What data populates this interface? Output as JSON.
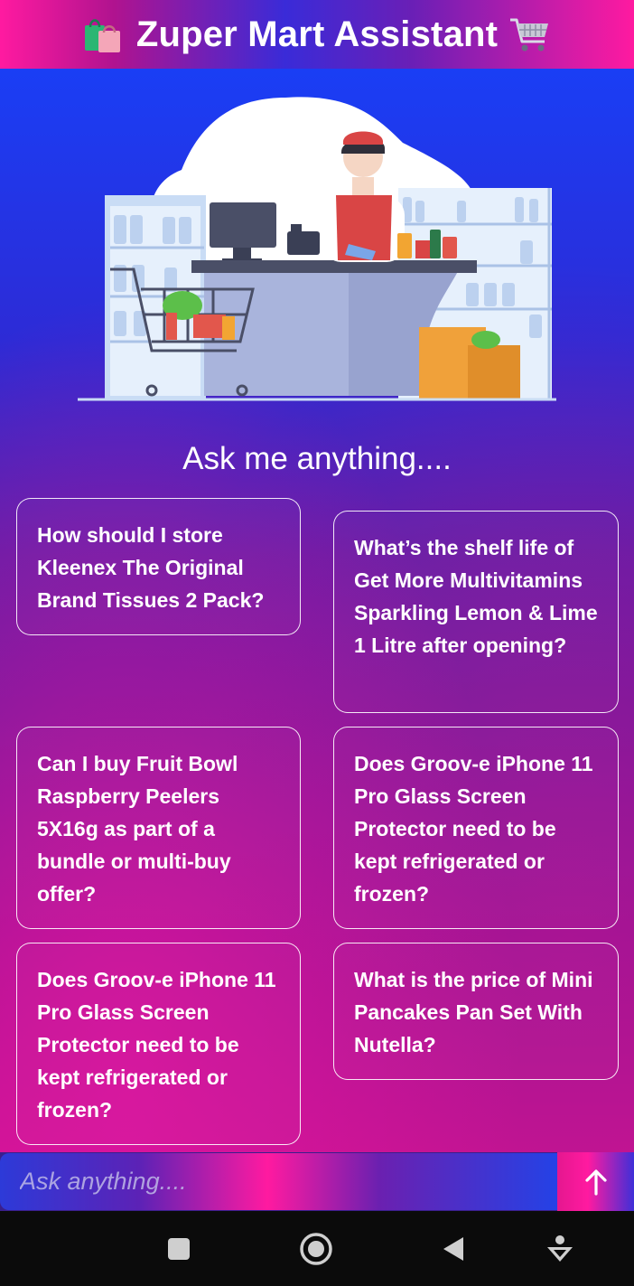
{
  "header": {
    "title": "Zuper Mart Assistant",
    "left_icon": "shopping-bags-icon",
    "right_icon": "shopping-cart-icon"
  },
  "main": {
    "illustration": "cashier-at-checkout-counter",
    "prompt_heading": "Ask me anything....",
    "suggestions": [
      "How should I store Kleenex The Original Brand Tissues 2 Pack?",
      "What’s the shelf life of Get More Multivitamins Sparkling Lemon & Lime 1 Litre after opening?",
      "Can I buy Fruit Bowl Raspberry Peelers 5X16g as part of a bundle or multi-buy offer?",
      "Does Groov-e iPhone 11 Pro Glass Screen Protector need to be kept refrigerated or frozen?",
      "Does Groov-e iPhone 11 Pro Glass Screen Protector need to be kept refrigerated or frozen?",
      "What is the price of Mini Pancakes Pan Set With Nutella?"
    ]
  },
  "input": {
    "placeholder": "Ask anything....",
    "value": "",
    "send_icon": "arrow-up-icon"
  },
  "navbar": {
    "items": [
      "square-icon",
      "circle-icon",
      "back-triangle-icon",
      "accessibility-icon"
    ]
  },
  "colors": {
    "accent_pink": "#ff1aa0",
    "accent_blue": "#1a3ef5",
    "accent_purple": "#6d1a9c",
    "text": "#ffffff"
  }
}
